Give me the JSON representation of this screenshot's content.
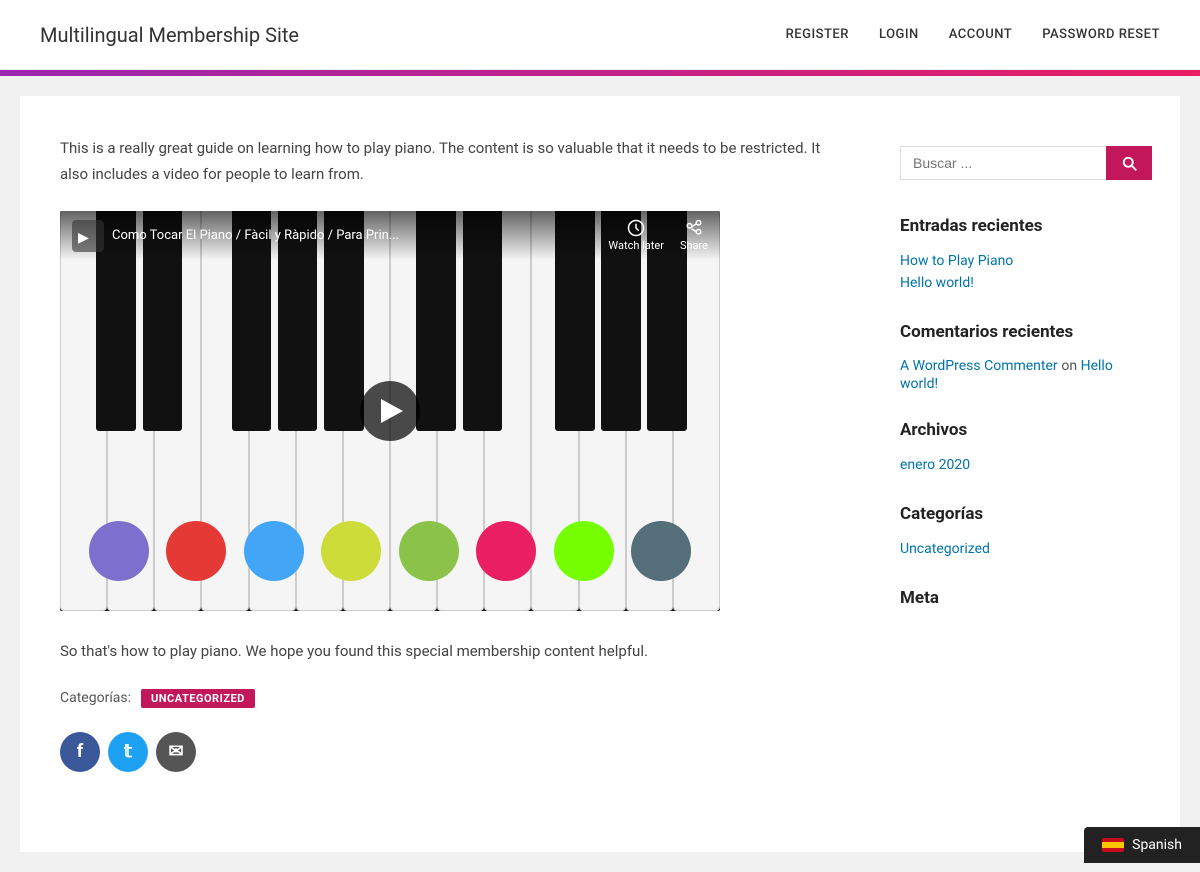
{
  "site": {
    "title": "Multilingual Membership Site"
  },
  "nav": {
    "items": [
      {
        "label": "REGISTER",
        "key": "register"
      },
      {
        "label": "LOGIN",
        "key": "login"
      },
      {
        "label": "ACCOUNT",
        "key": "account"
      },
      {
        "label": "PASSWORD RESET",
        "key": "password-reset"
      }
    ]
  },
  "content": {
    "intro_text": "This is a really great guide on learning how to play piano. The content is so valuable that it needs to be restricted. It also includes a video for people to learn from.",
    "outro_text": "So that's how to play piano. We hope you found this special membership content helpful.",
    "categories_label": "Categorías:",
    "uncategorized_badge": "UNCATEGORIZED"
  },
  "video": {
    "title": "Como Tocar El Piano / Fàcil y Ràpido / Para Prin...",
    "watch_later_label": "Watch later",
    "share_label": "Share"
  },
  "sidebar": {
    "search_placeholder": "Buscar ...",
    "search_button_label": "Search",
    "recent_posts_title": "Entradas recientes",
    "recent_posts": [
      {
        "label": "How to Play Piano"
      },
      {
        "label": "Hello world!"
      }
    ],
    "recent_comments_title": "Comentarios recientes",
    "recent_comments": [
      {
        "commenter": "A WordPress Commenter",
        "on": "on",
        "post": "Hello world!"
      }
    ],
    "archives_title": "Archivos",
    "archives": [
      {
        "label": "enero 2020"
      }
    ],
    "categories_title": "Categorías",
    "categories": [
      {
        "label": "Uncategorized"
      }
    ],
    "meta_title": "Meta"
  },
  "language": {
    "label": "Spanish",
    "flag": "es"
  },
  "colors": {
    "accent": "#c2185b",
    "link": "#0073aa",
    "header_bg": "#ffffff",
    "purple_bar_start": "#9c27b0",
    "purple_bar_end": "#e91e63"
  },
  "piano_dots": [
    {
      "color": "#7c6fcd",
      "label": "purple"
    },
    {
      "color": "#e53935",
      "label": "red"
    },
    {
      "color": "#42a5f5",
      "label": "blue"
    },
    {
      "color": "#cddc39",
      "label": "yellow-green"
    },
    {
      "color": "#8bc34a",
      "label": "light-green"
    },
    {
      "color": "#e91e63",
      "label": "pink"
    },
    {
      "color": "#76ff03",
      "label": "bright-green"
    },
    {
      "color": "#546e7a",
      "label": "steel-blue"
    }
  ]
}
